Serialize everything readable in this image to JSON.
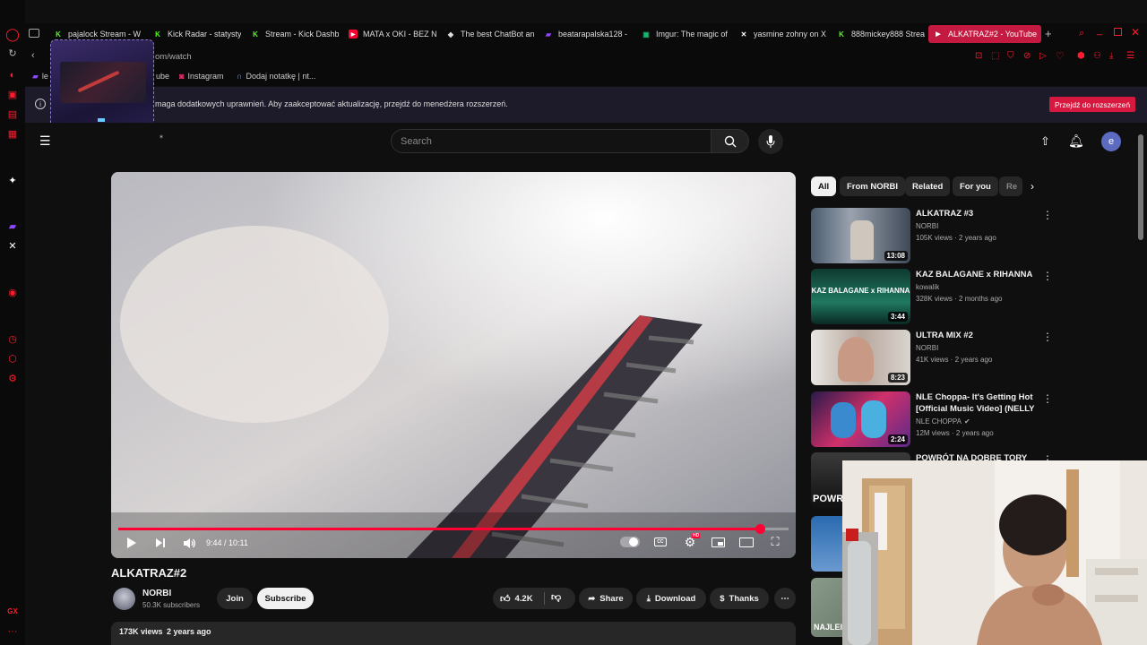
{
  "browser": {
    "tabs": [
      {
        "label": "pajalock Stream - W",
        "icon": "kick-icon",
        "color": "#53fc18"
      },
      {
        "label": "Kick Radar - statysty",
        "icon": "kick-icon",
        "color": "#53fc18"
      },
      {
        "label": "Stream - Kick Dashb",
        "icon": "kick-icon",
        "color": "#53fc18"
      },
      {
        "label": "MATA x OKI - BEZ N",
        "icon": "youtube-icon",
        "color": "#ff0033"
      },
      {
        "label": "The best ChatBot an",
        "icon": "bot-icon",
        "color": "#dddddd"
      },
      {
        "label": "beatarapalska128 - ",
        "icon": "twitch-icon",
        "color": "#9146ff"
      },
      {
        "label": "Imgur: The magic of",
        "icon": "imgur-icon",
        "color": "#1bb76e"
      },
      {
        "label": "yasmine zohny on X",
        "icon": "x-icon",
        "color": "#ffffff"
      },
      {
        "label": "888mickey888 Strea",
        "icon": "kick-icon",
        "color": "#53fc18"
      },
      {
        "label": "ALKATRAZ#2 - YouTube",
        "icon": "youtube-icon",
        "color": "#ffffff"
      }
    ],
    "new_tab": "+",
    "address": "om/watch",
    "bookmarks": [
      {
        "label": "le",
        "icon": "twitch-icon"
      },
      {
        "label": "ube",
        "icon": "youtube-icon"
      },
      {
        "label": "Instagram",
        "icon": "instagram-icon"
      },
      {
        "label": "Dodaj notatkę | nt...",
        "icon": "note-icon"
      }
    ],
    "banner_text": "maga dodatkowych uprawnień. Aby zaakceptować aktualizację, przejdź do menedżera rozszerzeń.",
    "banner_button": "Przejdź do rozszerzeń"
  },
  "youtube": {
    "search_placeholder": "Search",
    "avatar_letter": "e",
    "video": {
      "title": "ALKATRAZ#2",
      "time": "9:44 / 10:11",
      "progress": 0.957,
      "channel": "NORBI",
      "subscribers": "50.3K subscribers",
      "join": "Join",
      "subscribe": "Subscribe",
      "likes": "4.2K",
      "share": "Share",
      "download": "Download",
      "thanks": "Thanks",
      "views": "173K views",
      "age": "2 years ago",
      "hd_badge": "HD"
    },
    "chips": [
      "All",
      "From NORBI",
      "Related",
      "For you",
      "Re"
    ],
    "recommendations": [
      {
        "title": "ALKATRAZ #3",
        "channel": "NORBI",
        "meta": "105K views · 2 years ago",
        "duration": "13:08"
      },
      {
        "title": "KAZ BALAGANE x RIHANNA",
        "channel": "kowalik",
        "meta": "328K views · 2 months ago",
        "duration": "3:44",
        "thumb_text": "KAZ BALAGANE x RIHANNA"
      },
      {
        "title": "ULTRA MIX #2",
        "channel": "NORBI",
        "meta": "41K views · 2 years ago",
        "duration": "8:23"
      },
      {
        "title": "NLE Choppa- It's Getting Hot [Official Music Video] (NELLY ...",
        "channel": "NLE CHOPPA",
        "meta": "12M views · 2 years ago",
        "duration": "2:24"
      },
      {
        "title": "POWRÓT NA DOBRE TORY NA",
        "channel": "",
        "meta": "",
        "duration": "",
        "thumb_text": "POWRÓ"
      },
      {
        "title": "",
        "channel": "",
        "meta": "",
        "duration": ""
      },
      {
        "title": "",
        "channel": "",
        "meta": "",
        "duration": "",
        "thumb_text": "NAJLEI"
      }
    ]
  },
  "colors": {
    "accent": "#ff0033",
    "tab_active": "#c41940",
    "opera_red": "#ff1b2d",
    "banner_btn": "#d7193f"
  }
}
